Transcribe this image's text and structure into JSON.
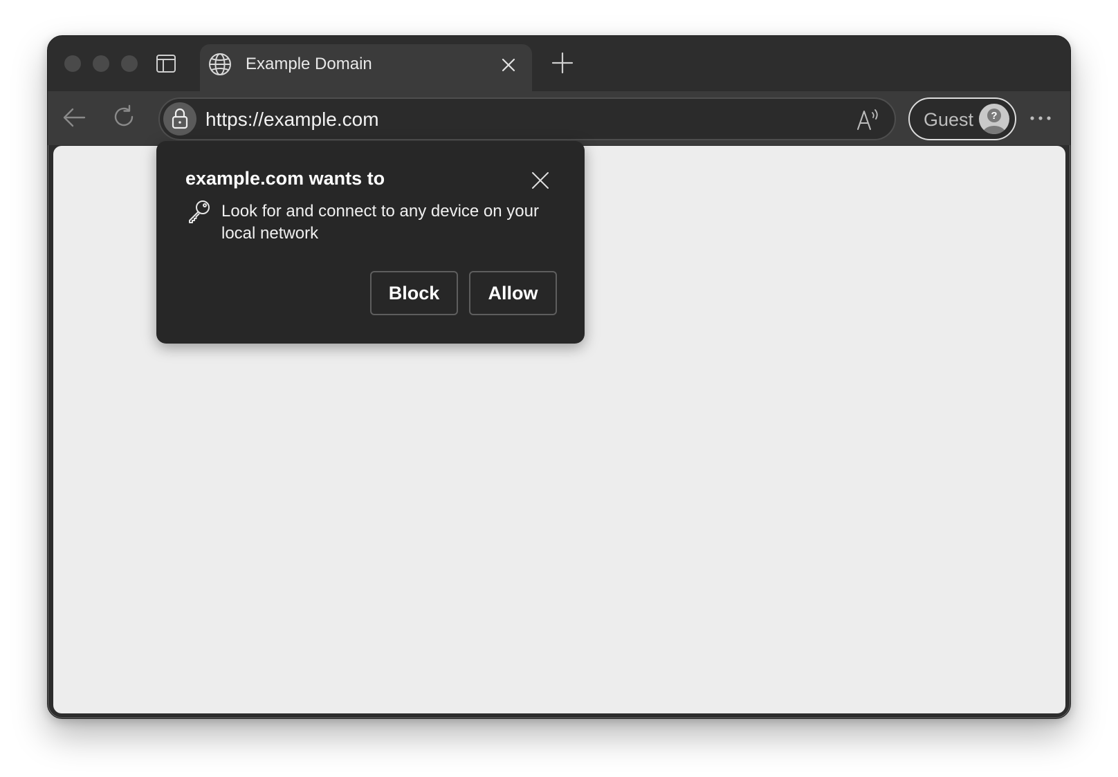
{
  "tab": {
    "title": "Example Domain"
  },
  "toolbar": {
    "url": "https://example.com",
    "profile_label": "Guest"
  },
  "popup": {
    "title": "example.com wants to",
    "message": "Look for and connect to any device on your local network",
    "block_label": "Block",
    "allow_label": "Allow"
  },
  "colors": {
    "frame": "#2d2d2d",
    "toolbar": "#3b3b3b",
    "content": "#ededed",
    "popup": "#272727"
  }
}
